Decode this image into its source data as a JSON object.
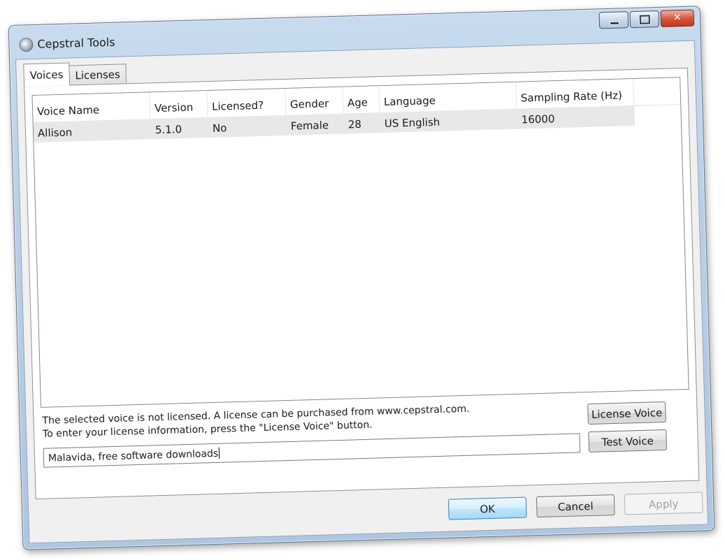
{
  "window": {
    "title": "Cepstral Tools",
    "controls": {
      "close_glyph": "✕"
    }
  },
  "tabs": [
    {
      "label": "Voices",
      "active": true
    },
    {
      "label": "Licenses",
      "active": false
    }
  ],
  "voice_table": {
    "columns": [
      "Voice Name",
      "Version",
      "Licensed?",
      "Gender",
      "Age",
      "Language",
      "Sampling Rate (Hz)"
    ],
    "rows": [
      [
        "Allison",
        "5.1.0",
        "No",
        "Female",
        "28",
        "US English",
        "16000"
      ]
    ]
  },
  "status": {
    "line1": "The selected voice is not licensed.  A license can be purchased from www.cepstral.com.",
    "line2": "To enter your license information, press the \"License Voice\" button."
  },
  "test_text": {
    "value": "Malavida, free software downloads"
  },
  "buttons": {
    "license_voice": "License Voice",
    "test_voice": "Test Voice",
    "ok": "OK",
    "cancel": "Cancel",
    "apply": "Apply"
  }
}
